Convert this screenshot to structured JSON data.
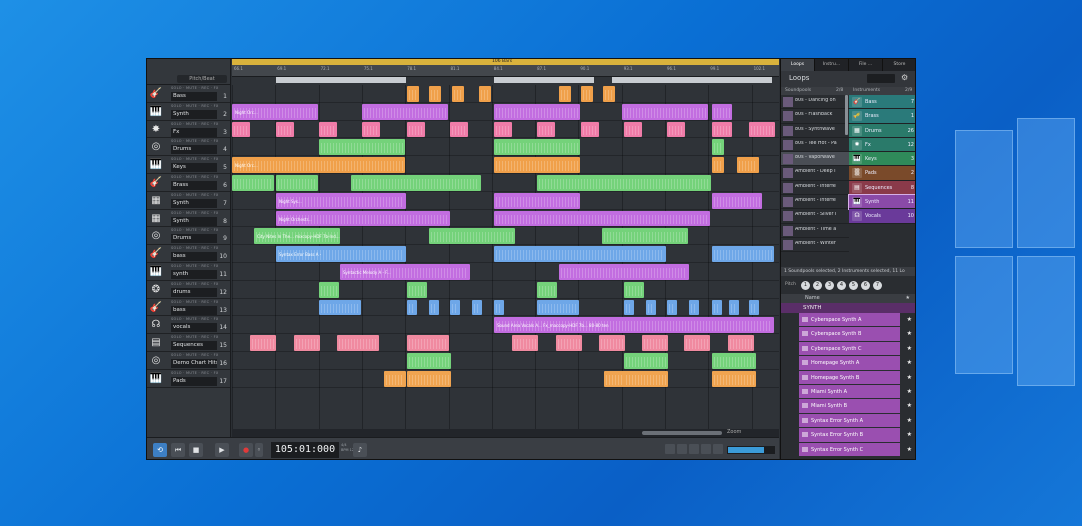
{
  "window": {
    "ruler_label": "106 Bars"
  },
  "tracks_header": {
    "pitch_label": "Pitch/Beat"
  },
  "track_buttons": "SOLO · MUTE · REC · FX",
  "tracks": [
    {
      "name": "Bass",
      "num": "1",
      "icon": "guitar-icon",
      "glyph": "🎸"
    },
    {
      "name": "Synth",
      "num": "2",
      "icon": "keyboard-icon",
      "glyph": "🎹"
    },
    {
      "name": "Fx",
      "num": "3",
      "icon": "burst-icon",
      "glyph": "✸"
    },
    {
      "name": "Drums",
      "num": "4",
      "icon": "drum-icon",
      "glyph": "◎"
    },
    {
      "name": "Keys",
      "num": "5",
      "icon": "keyboard-icon",
      "glyph": "🎹"
    },
    {
      "name": "Brass",
      "num": "6",
      "icon": "guitar-icon",
      "glyph": "🎸"
    },
    {
      "name": "Synth",
      "num": "7",
      "icon": "synth-icon",
      "glyph": "▦"
    },
    {
      "name": "Synth",
      "num": "8",
      "icon": "synth-icon",
      "glyph": "▦"
    },
    {
      "name": "Drums",
      "num": "9",
      "icon": "drum-icon",
      "glyph": "◎"
    },
    {
      "name": "bass",
      "num": "10",
      "icon": "guitar-icon",
      "glyph": "🎸"
    },
    {
      "name": "synth",
      "num": "11",
      "icon": "keyboard-icon",
      "glyph": "🎹"
    },
    {
      "name": "drums",
      "num": "12",
      "icon": "drum-kit-icon",
      "glyph": "❂"
    },
    {
      "name": "bass",
      "num": "13",
      "icon": "guitar-icon",
      "glyph": "🎸"
    },
    {
      "name": "vocals",
      "num": "14",
      "icon": "vocals-icon",
      "glyph": "☊"
    },
    {
      "name": "Sequences",
      "num": "15",
      "icon": "sequence-icon",
      "glyph": "▤"
    },
    {
      "name": "Demo Chart Hits Ren",
      "num": "16",
      "icon": "drum-icon",
      "glyph": "◎"
    },
    {
      "name": "Pads",
      "num": "17",
      "icon": "keyboard-icon",
      "glyph": "🎹"
    }
  ],
  "ruler_marks": [
    "66.1",
    "69.1",
    "72.1",
    "75.1",
    "78.1",
    "81.1",
    "84.1",
    "87.1",
    "90.1",
    "93.1",
    "96.1",
    "99.1",
    "102.1",
    "105.1"
  ],
  "clips": {
    "labels": {
      "synth_2": "Night Orc...",
      "keys_5": "Night Orc...",
      "synth_7": "Night Sys...",
      "synth_8": "Night Orchestr...",
      "drums_9": "City Nites In The... mixcopy-HDF 7b-Ind...",
      "bass_10": "Syntax Error Bass A -",
      "synth_11": "Syntactic Melody A - F...",
      "vocals_14": "Sound Area Vocals A... Fx_maccopy-HDF 7b... 80-80 ten"
    }
  },
  "transport": {
    "time": "105:01:000",
    "bpm": "BPM 120.000",
    "sig": "4/4",
    "zoom": "Zoom"
  },
  "right_panel": {
    "tabs": [
      "Loops",
      "Instru...",
      "File ...",
      "Store"
    ],
    "loops_title": "Loops",
    "soundpools_label": "Soundpools",
    "soundpools_count": "2/8",
    "instruments_label": "Instruments",
    "instruments_count": "2/9",
    "soundpools": [
      "80s - Dancing on",
      "80s - Flashback",
      "80s - Synthwave",
      "80s - Tee Hot - Pa",
      "80s - Vaporwave",
      "Ambient - Deep I",
      "Ambient - Interfe",
      "Ambient - Interfe",
      "Ambient - Silver I",
      "Ambient - Time a",
      "Ambient - Winter"
    ],
    "instruments": [
      {
        "name": "Bass",
        "count": "7",
        "color": "#2a7a7a"
      },
      {
        "name": "Brass",
        "count": "1",
        "color": "#2a7a7a"
      },
      {
        "name": "Drums",
        "count": "26",
        "color": "#2a7a6a"
      },
      {
        "name": "Fx",
        "count": "12",
        "color": "#2a7a6a"
      },
      {
        "name": "Keys",
        "count": "3",
        "color": "#2f8a5a"
      },
      {
        "name": "Pads",
        "count": "2",
        "color": "#7a4a2a"
      },
      {
        "name": "Sequences",
        "count": "8",
        "color": "#8a3a4a"
      },
      {
        "name": "Synth",
        "count": "11",
        "color": "#8a4aa8"
      },
      {
        "name": "Vocals",
        "count": "10",
        "color": "#6a3a9a"
      }
    ],
    "status": "1 Soundpools selected, 2 Instruments selected, 11 Lo",
    "pitch_label": "Pitch",
    "pitch_nums": [
      "1",
      "2",
      "3",
      "4",
      "5",
      "6",
      "7"
    ],
    "name_col": "Name",
    "synth_header": "SYNTH",
    "synth_loops": [
      "Cyberspace Synth A",
      "Cyberspace Synth B",
      "Cyberspace Synth C",
      "Homepage Synth A",
      "Homepage Synth B",
      "Miami Synth A",
      "Miami Synth B",
      "Syntax Error Synth A",
      "Syntax Error Synth B",
      "Syntax Error Synth C"
    ]
  },
  "colors": {
    "bass": "#6ea7e8",
    "synth": "#c26de0",
    "fx": "#f07ca8",
    "drums": "#74d27a",
    "keys": "#f0a04a",
    "sequences": "#f08aa0",
    "pads": "#f0a450"
  }
}
